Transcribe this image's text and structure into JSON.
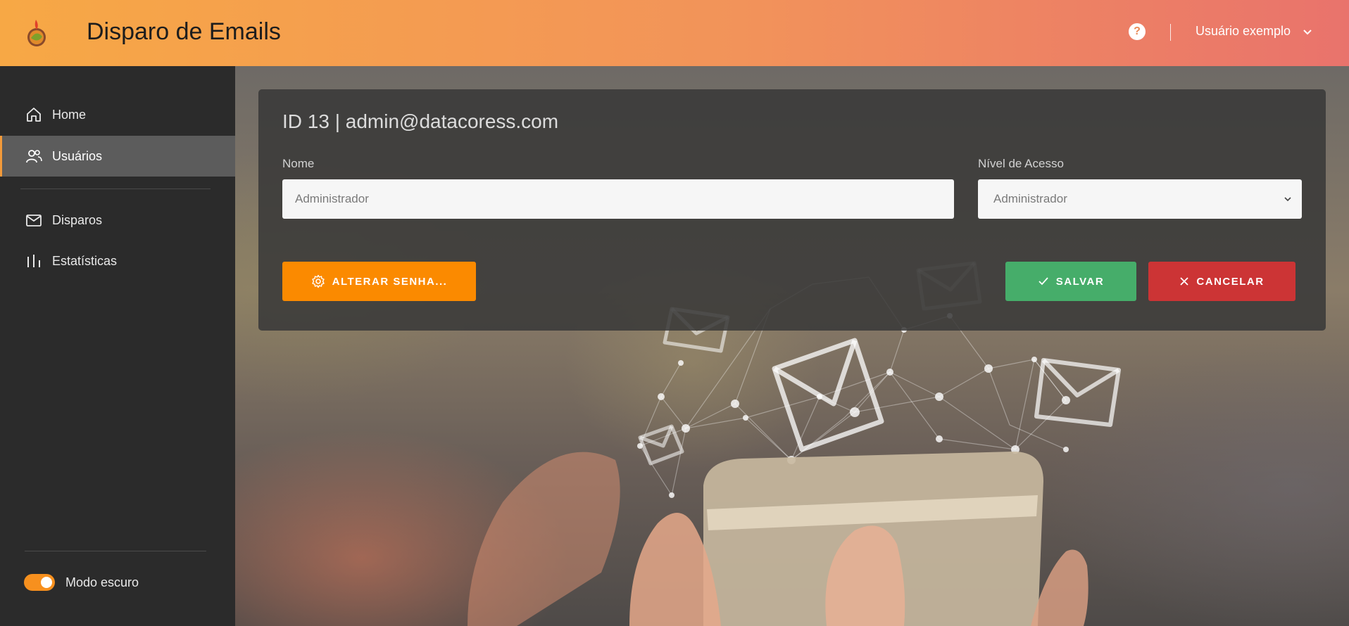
{
  "header": {
    "app_title": "Disparo de Emails",
    "help_icon": "?",
    "user_name": "Usuário exemplo"
  },
  "sidebar": {
    "items": [
      {
        "label": "Home",
        "icon": "home-icon",
        "active": false
      },
      {
        "label": "Usuários",
        "icon": "users-icon",
        "active": true
      },
      {
        "label": "Disparos",
        "icon": "mail-icon",
        "active": false
      },
      {
        "label": "Estatísticas",
        "icon": "bar-chart-icon",
        "active": false
      }
    ],
    "dark_mode_label": "Modo escuro",
    "dark_mode_on": true
  },
  "card": {
    "title": "ID 13 | admin@datacoress.com",
    "name_label": "Nome",
    "name_value": "Administrador",
    "access_label": "Nível de Acesso",
    "access_value": "Administrador"
  },
  "buttons": {
    "change_password": "ALTERAR SENHA...",
    "save": "SALVAR",
    "cancel": "CANCELAR"
  },
  "colors": {
    "header_start": "#f7a845",
    "header_end": "#e9736c",
    "accent_orange": "#fb8a00",
    "save_green": "#46ad6a",
    "cancel_red": "#cc3435",
    "sidebar_bg": "#2b2b2b"
  }
}
